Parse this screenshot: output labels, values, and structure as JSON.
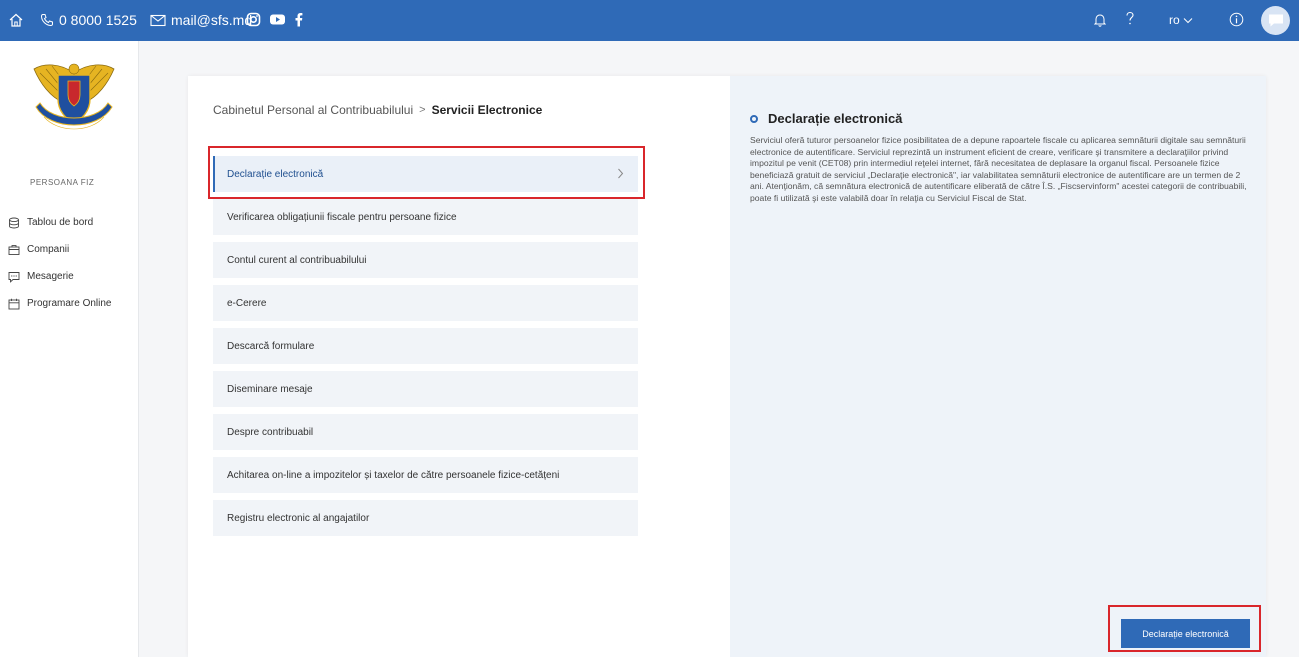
{
  "topbar": {
    "phone": "0 8000 1525",
    "email": "mail@sfs.md",
    "language": "ro"
  },
  "sidebar": {
    "user_name": "PERSOANA FIZ",
    "items": [
      {
        "label": "Tablou de bord",
        "icon": "database-icon"
      },
      {
        "label": "Companii",
        "icon": "briefcase-icon"
      },
      {
        "label": "Mesagerie",
        "icon": "chat-icon"
      },
      {
        "label": "Programare Online",
        "icon": "calendar-icon"
      }
    ]
  },
  "breadcrumb": {
    "parent": "Cabinetul Personal al Contribuabilului",
    "separator": ">",
    "current": "Servicii Electronice"
  },
  "services": [
    {
      "label": "Declarație electronică",
      "active": true
    },
    {
      "label": "Verificarea obligațiunii fiscale pentru persoane fizice"
    },
    {
      "label": "Contul curent al contribuabilului"
    },
    {
      "label": "e-Cerere"
    },
    {
      "label": "Descarcă formulare"
    },
    {
      "label": "Diseminare mesaje"
    },
    {
      "label": "Despre contribuabil"
    },
    {
      "label": "Achitarea on-line a impozitelor și taxelor de către persoanele fizice-cetățeni"
    },
    {
      "label": "Registru electronic al angajatilor"
    }
  ],
  "detail": {
    "title": "Declarație electronică",
    "description": "Serviciul oferă tuturor persoanelor fizice posibilitatea de a depune rapoartele fiscale cu aplicarea semnăturii digitale sau semnăturii electronice de autentificare. Serviciul reprezintă un instrument eficient de creare, verificare şi transmitere a declaraţiilor privind impozitul pe venit (CET08) prin intermediul reţelei internet, fără necesitatea de deplasare la organul fiscal. Persoanele fizice beneficiază gratuit de serviciul „Declaraţie electronică\", iar valabilitatea semnăturii electronice de autentificare are un termen de 2 ani. Atenţionăm, că semnătura electronică de autentificare eliberată de către Î.S. „Fiscservinform\" acestei categorii de contribuabili, poate fi utilizată şi este valabilă doar în relaţia cu Serviciul Fiscal de Stat.",
    "button_label": "Declarație electronică"
  },
  "colors": {
    "topbar": "#2f6ab7",
    "accent": "#2f6ab7",
    "highlight": "#d9262b",
    "detail_bg": "#eef3f9"
  }
}
